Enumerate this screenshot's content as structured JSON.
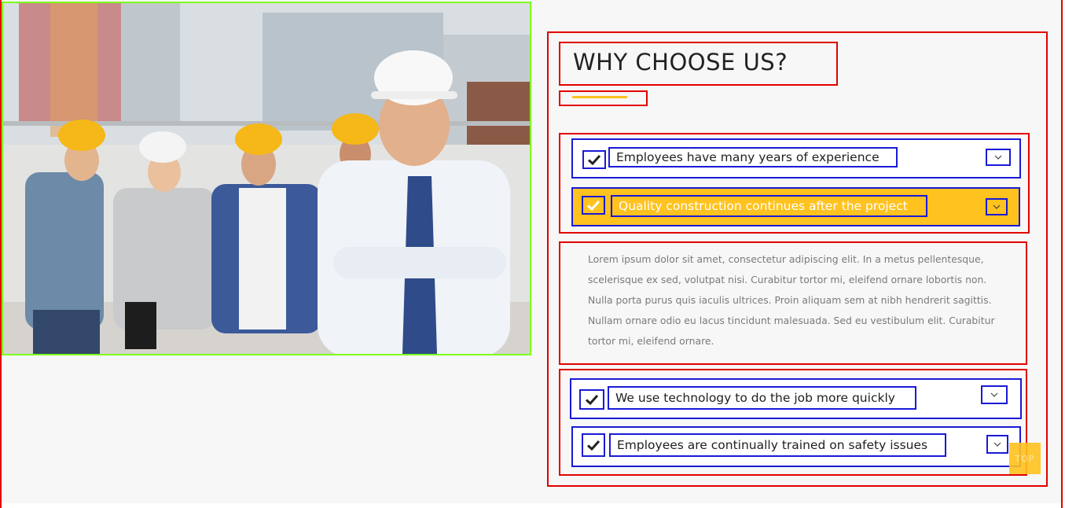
{
  "section": {
    "title": "WHY CHOOSE US?",
    "accent_color": "#ffc21f",
    "items": [
      {
        "label": "Employees have many years of experience",
        "icon": "check-icon",
        "expanded": false
      },
      {
        "label": "Quality construction continues after the project",
        "icon": "check-icon",
        "expanded": true
      },
      {
        "label": "We use technology to do the job more quickly",
        "icon": "check-icon",
        "expanded": false
      },
      {
        "label": "Employees are continually trained on safety issues",
        "icon": "check-icon",
        "expanded": false
      }
    ],
    "body": "Lorem ipsum dolor sit amet, consectetur adipiscing elit. In a metus pellentesque, scelerisque ex sed, volutpat nisi. Curabitur tortor mi, eleifend ornare lobortis non. Nulla porta purus quis iaculis ultrices. Proin aliquam sem at nibh hendrerit sagittis. Nullam ornare odio eu lacus tincidunt malesuada. Sed eu vestibulum elit. Curabitur tortor mi, eleifend ornare."
  },
  "back_to_top": {
    "label": "TOP"
  }
}
